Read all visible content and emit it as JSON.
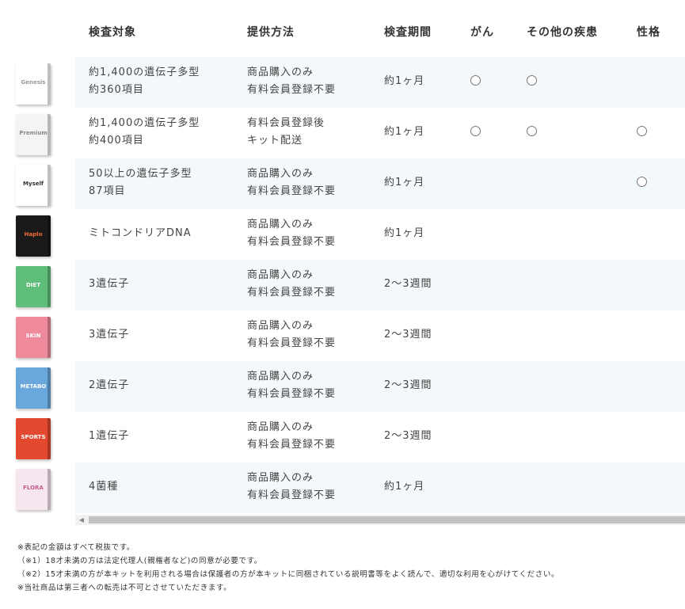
{
  "headers": {
    "target": "検査対象",
    "method": "提供方法",
    "period": "検査期間",
    "cancer": "がん",
    "other": "その他の疾患",
    "trait": "性格"
  },
  "mark_symbol": "",
  "rows": [
    {
      "thumb_label": "Genesis",
      "thumb_bg": "#ffffff",
      "thumb_fg": "#999999",
      "target_l1": "約1,400の遺伝子多型",
      "target_l2": "約360項目",
      "method_l1": "商品購入のみ",
      "method_l2": "有料会員登録不要",
      "period": "約1ヶ月",
      "cancer": true,
      "other": true,
      "trait": false
    },
    {
      "thumb_label": "Premium",
      "thumb_bg": "#f4f4f4",
      "thumb_fg": "#888888",
      "target_l1": "約1,400の遺伝子多型",
      "target_l2": "約400項目",
      "method_l1": "有料会員登録後",
      "method_l2": "キット配送",
      "period": "約1ヶ月",
      "cancer": true,
      "other": true,
      "trait": true
    },
    {
      "thumb_label": "Myself",
      "thumb_bg": "#ffffff",
      "thumb_fg": "#333333",
      "target_l1": "50以上の遺伝子多型",
      "target_l2": "87項目",
      "method_l1": "商品購入のみ",
      "method_l2": "有料会員登録不要",
      "period": "約1ヶ月",
      "cancer": false,
      "other": false,
      "trait": true
    },
    {
      "thumb_label": "Haplo",
      "thumb_bg": "#1a1a1a",
      "thumb_fg": "#f06a3a",
      "target_l1": "ミトコンドリアDNA",
      "target_l2": "",
      "method_l1": "商品購入のみ",
      "method_l2": "有料会員登録不要",
      "period": "約1ヶ月",
      "cancer": false,
      "other": false,
      "trait": false
    },
    {
      "thumb_label": "DIET",
      "thumb_bg": "#5fbf7a",
      "thumb_fg": "#ffffff",
      "target_l1": "3遺伝子",
      "target_l2": "",
      "method_l1": "商品購入のみ",
      "method_l2": "有料会員登録不要",
      "period": "2〜3週間",
      "cancer": false,
      "other": false,
      "trait": false
    },
    {
      "thumb_label": "SKIN",
      "thumb_bg": "#ef8a9c",
      "thumb_fg": "#ffffff",
      "target_l1": "3遺伝子",
      "target_l2": "",
      "method_l1": "商品購入のみ",
      "method_l2": "有料会員登録不要",
      "period": "2〜3週間",
      "cancer": false,
      "other": false,
      "trait": false
    },
    {
      "thumb_label": "METABO",
      "thumb_bg": "#6aa7dc",
      "thumb_fg": "#ffffff",
      "target_l1": "2遺伝子",
      "target_l2": "",
      "method_l1": "商品購入のみ",
      "method_l2": "有料会員登録不要",
      "period": "2〜3週間",
      "cancer": false,
      "other": false,
      "trait": false
    },
    {
      "thumb_label": "SPORTS",
      "thumb_bg": "#e2492f",
      "thumb_fg": "#ffffff",
      "target_l1": "1遺伝子",
      "target_l2": "",
      "method_l1": "商品購入のみ",
      "method_l2": "有料会員登録不要",
      "period": "2〜3週間",
      "cancer": false,
      "other": false,
      "trait": false
    },
    {
      "thumb_label": "FLORA",
      "thumb_bg": "#f6e6ef",
      "thumb_fg": "#c25a8e",
      "target_l1": "4菌種",
      "target_l2": "",
      "method_l1": "商品購入のみ",
      "method_l2": "有料会員登録不要",
      "period": "約1ヶ月",
      "cancer": false,
      "other": false,
      "trait": false
    }
  ],
  "notes": [
    "※表記の金額はすべて税抜です。",
    "（※1）18才未満の方は法定代理人(親権者など)の同意が必要です。",
    "（※2）15才未満の方が本キットを利用される場合は保護者の方が本キットに同梱されている説明書等をよく読んで、適切な利用を心がけてください。",
    "※当社商品は第三者への転売は不可とさせていただきます。"
  ],
  "scroll_left_glyph": "◀"
}
